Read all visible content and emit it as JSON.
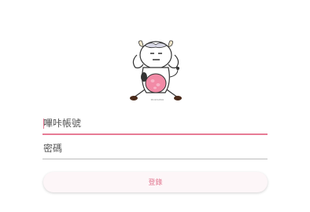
{
  "mascot": {
    "icon": "cow-mascot-icon",
    "caption": "MOOSPRO"
  },
  "form": {
    "username_placeholder": "嗶咔帳號",
    "password_placeholder": "密碼",
    "login_label": "登錄"
  },
  "colors": {
    "accent": "#e77b95",
    "button_bg": "#fdf6f8",
    "divider": "#bdbdbd"
  }
}
